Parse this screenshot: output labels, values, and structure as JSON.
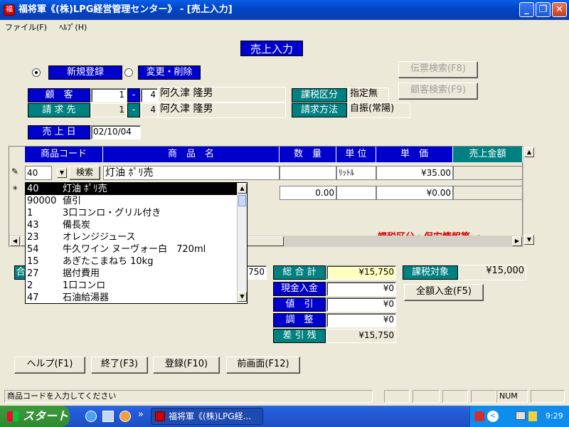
{
  "window": {
    "title": "福将軍《(株)LPG経営管理センター》 - [売上入力]",
    "minimize": "_",
    "restore": "❐",
    "close": "✕"
  },
  "menu": [
    "ファイル(F)",
    "ﾍﾙﾌﾟ(H)"
  ],
  "form": {
    "title": "売上入力",
    "radio_new": "新規登録",
    "radio_change": "変更・削除",
    "btn_voucher_search": "伝票検索(F8)",
    "btn_customer_search": "顧客検索(F9)",
    "customer_label": "顧　客",
    "customer_code1": "1",
    "customer_dash": "-",
    "customer_code2": "4",
    "customer_name": "阿久津 隆男",
    "billing_label": "請 求 先",
    "billing_code1": "1",
    "billing_dash": "-",
    "billing_code2": "4",
    "billing_name": "阿久津 隆男",
    "tax_label": "課税区分",
    "tax_value": "指定無",
    "billing_method_label": "請求方法",
    "billing_method_value": "自振(常陽)",
    "sales_date_label": "売 上 日",
    "sales_date_value": "02/10/04"
  },
  "grid": {
    "headers": [
      "商品コード",
      "商　品　名",
      "数　量",
      "単 位",
      "単　価",
      "売上金額"
    ],
    "row1": {
      "marker": "✎",
      "code": "40",
      "search": "検索",
      "name": "灯油 ﾎﾟﾘ売",
      "unit": "ﾘｯﾄﾙ",
      "price": "¥35.00"
    },
    "row2": {
      "marker": "*",
      "qty": "0.00",
      "price": "¥0.00"
    },
    "note": "課税区分・保安情報等 →"
  },
  "dropdown": [
    {
      "code": "40",
      "name": "灯油 ﾎﾟﾘ売"
    },
    {
      "code": "90000",
      "name": "値引"
    },
    {
      "code": "1",
      "name": "3口コンロ・グリル付き"
    },
    {
      "code": "43",
      "name": "備長炭"
    },
    {
      "code": "23",
      "name": "オレンジジュース"
    },
    {
      "code": "54",
      "name": "牛久ワイン ヌーヴォー白　720ml"
    },
    {
      "code": "15",
      "name": "あぎたこまねち 10kg"
    },
    {
      "code": "27",
      "name": "据付費用"
    },
    {
      "code": "2",
      "name": "1口コンロ"
    },
    {
      "code": "47",
      "name": "石油給湯器"
    }
  ],
  "hidden_left": {
    "label": "合",
    "value": "750"
  },
  "totals": {
    "total_label": "総 合 計",
    "total_value": "¥15,750",
    "cash_label": "現金入金",
    "cash_value": "¥0",
    "discount_label": "値　引",
    "discount_value": "¥0",
    "adjust_label": "調　整",
    "adjust_value": "¥0",
    "balance_label": "差 引 残",
    "balance_value": "¥15,750",
    "taxable_label": "課税対象",
    "taxable_value": "¥15,000",
    "full_payment_btn": "全額入金(F5)"
  },
  "footer_buttons": [
    "ヘルプ(F1)",
    "終了(F3)",
    "登録(F10)",
    "前画面(F12)"
  ],
  "statusbar": {
    "message": "商品コードを入力してください",
    "num": "NUM"
  },
  "taskbar": {
    "start": "スタート",
    "task": "福将軍《(株)LPG経...",
    "clock": "9:29",
    "chevron": "»"
  }
}
